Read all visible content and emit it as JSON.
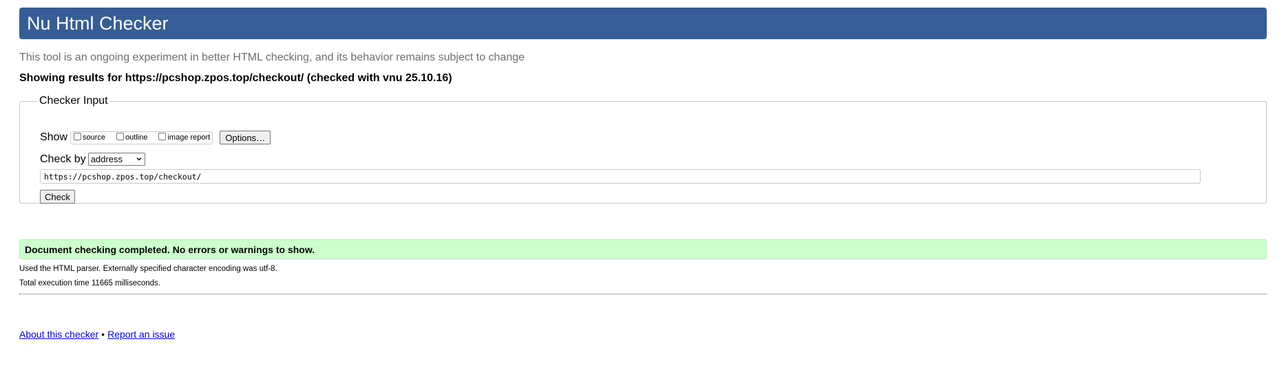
{
  "header": {
    "title": "Nu Html Checker"
  },
  "subtitle": "This tool is an ongoing experiment in better HTML checking, and its behavior remains subject to change",
  "results_for": "Showing results for https://pcshop.zpos.top/checkout/ (checked with vnu 25.10.16)",
  "checker_input": {
    "legend": "Checker Input",
    "show_label": "Show",
    "checkboxes": [
      {
        "label": "source",
        "checked": false
      },
      {
        "label": "outline",
        "checked": false
      },
      {
        "label": "image report",
        "checked": false
      }
    ],
    "options_button": "Options…",
    "check_by_label": "Check by",
    "check_by_selected": "address",
    "url_value": "https://pcshop.zpos.top/checkout/",
    "check_button": "Check"
  },
  "status": {
    "message": "Document checking completed. No errors or warnings to show.",
    "color": "#ccffcc"
  },
  "info": {
    "parser": "Used the HTML parser. Externally specified character encoding was utf-8.",
    "execution_time": "Total execution time 11665 milliseconds."
  },
  "footer": {
    "about_link": "About this checker",
    "separator": "•",
    "report_link": "Report an issue"
  },
  "colors": {
    "header_bg": "#365d95",
    "link": "#0000ee"
  }
}
